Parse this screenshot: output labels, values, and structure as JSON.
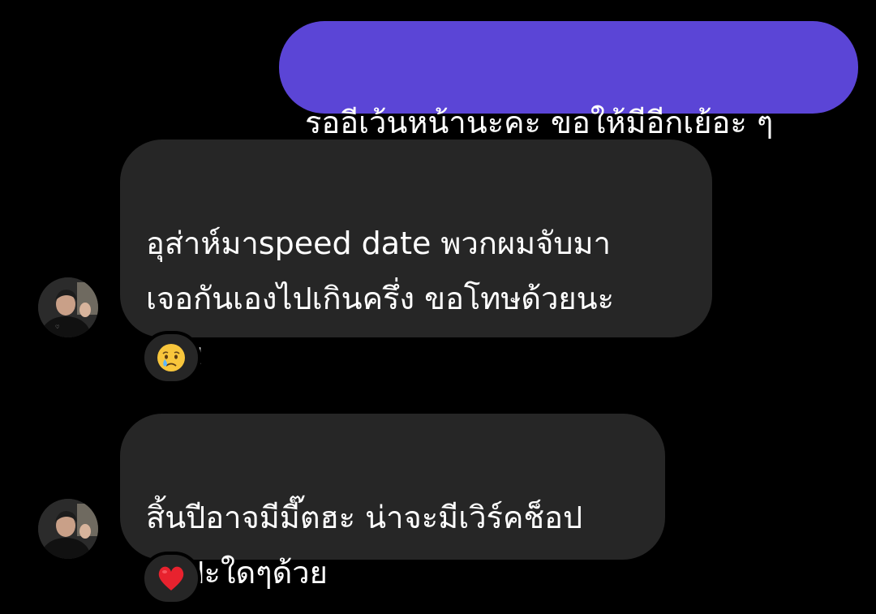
{
  "messages": [
    {
      "direction": "outgoing",
      "text": "รออีเว้นหน้านะคะ ขอให้มีอีกเย้อะ ๆ"
    },
    {
      "direction": "incoming",
      "text": "อุส่าห์มาspeed date พวกผมจับมา\nเจอกันเองไปเกินครึ่ง ขอโทษด้วยนะ\nครับ",
      "reaction": "crying-face-emoji"
    },
    {
      "direction": "incoming",
      "text": "สิ้นปีอาจมีมี๊ตฮะ น่าจะมีเวิร์คช็อป\nศิลปะใดๆด้วย",
      "reaction": "red-heart-emoji"
    }
  ],
  "colors": {
    "background": "#000000",
    "outgoing_bubble": "#5b45d6",
    "incoming_bubble": "#262626",
    "text": "#ffffff"
  }
}
